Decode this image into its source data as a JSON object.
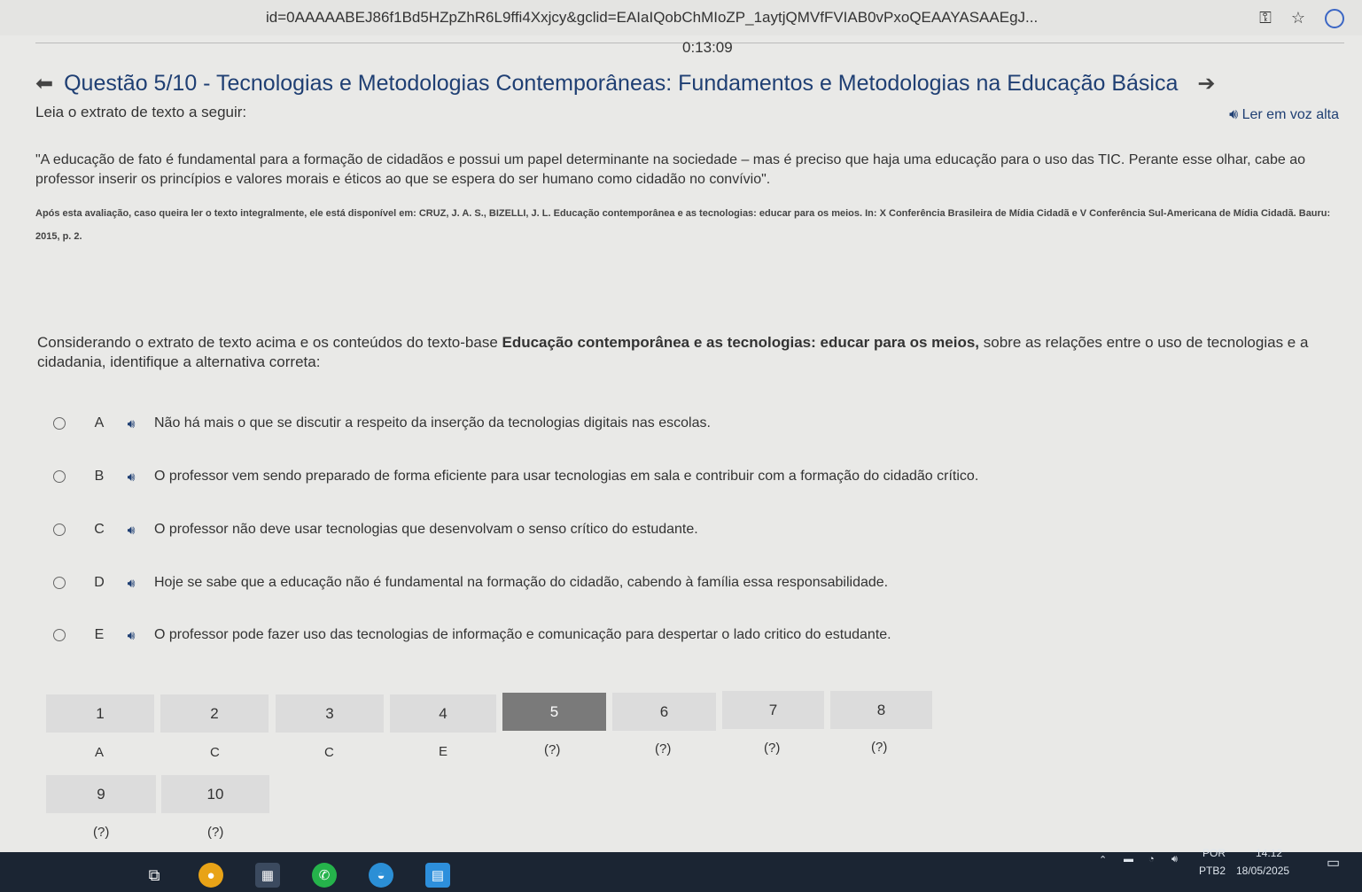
{
  "browser": {
    "url": "id=0AAAAABEJ86f1Bd5HZpZhR6L9ffi4Xxjcy&gclid=EAIaIQobChMIoZP_1aytjQMVfFVIAB0vPxoQEAAYASAAEgJ..."
  },
  "timer": "0:13:09",
  "header": {
    "title": "Questão 5/10 - Tecnologias e Metodologias Contemporâneas: Fundamentos e Metodologias na Educação Básica"
  },
  "lead": "Leia o extrato de texto a seguir:",
  "tts_label": "Ler em voz alta",
  "quote": "\"A educação de fato é fundamental para a formação de cidadãos e possui um papel determinante na sociedade – mas é preciso que haja uma educação para o uso das TIC. Perante esse olhar, cabe ao professor inserir os princípios e valores morais e éticos ao que se espera do ser humano como cidadão no convívio\".",
  "citation": "Após esta avaliação, caso queira ler o texto integralmente, ele está disponível em: CRUZ, J. A. S., BIZELLI, J. L. Educação contemporânea e as tecnologias: educar para os meios. In: X Conferência Brasileira de Mídia Cidadã e V Conferência Sul-Americana de Mídia Cidadã. Bauru: 2015, p. 2.",
  "prompt": {
    "before": "Considerando o extrato de texto acima e os conteúdos do texto-base ",
    "bold": "Educação contemporânea e as tecnologias: educar para os meios,",
    "after": " sobre as relações entre o uso de tecnologias e a cidadania, identifique a alternativa correta:"
  },
  "options": [
    {
      "letter": "A",
      "text": "Não há mais o que se discutir a respeito da inserção da tecnologias digitais nas escolas."
    },
    {
      "letter": "B",
      "text": "O professor vem sendo preparado de forma eficiente para usar tecnologias em sala e contribuir com a formação do cidadão crítico."
    },
    {
      "letter": "C",
      "text": "O professor não deve usar tecnologias que desenvolvam o senso crítico do estudante."
    },
    {
      "letter": "D",
      "text": "Hoje se sabe que a educação não é fundamental na formação do cidadão, cabendo à família essa responsabilidade."
    },
    {
      "letter": "E",
      "text": "O professor pode fazer uso das tecnologias de informação e comunicação para despertar o lado critico do estudante."
    }
  ],
  "navigator": [
    {
      "n": "1",
      "answer": "A"
    },
    {
      "n": "2",
      "answer": "C"
    },
    {
      "n": "3",
      "answer": "C"
    },
    {
      "n": "4",
      "answer": "E"
    },
    {
      "n": "5",
      "answer": "(?)"
    },
    {
      "n": "6",
      "answer": "(?)"
    },
    {
      "n": "7",
      "answer": "(?)"
    },
    {
      "n": "8",
      "answer": "(?)"
    },
    {
      "n": "9",
      "answer": "(?)"
    },
    {
      "n": "10",
      "answer": "(?)"
    }
  ],
  "tray": {
    "lang": "POR",
    "layout": "PTB2",
    "time": "14:12",
    "date": "18/05/2025"
  }
}
